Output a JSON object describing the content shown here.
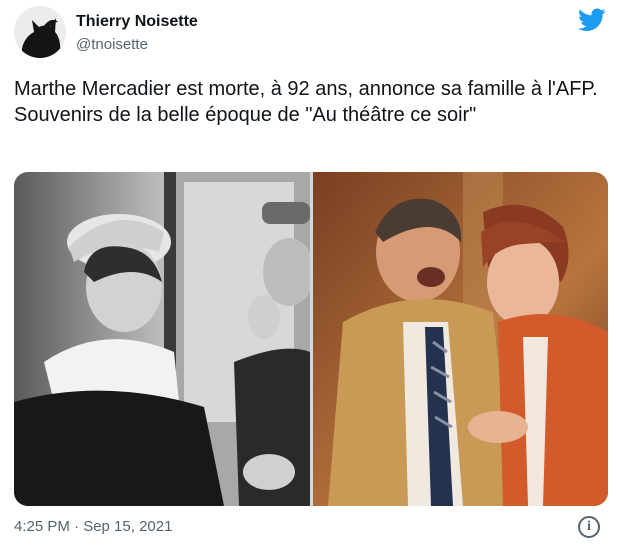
{
  "author": {
    "display_name": "Thierry Noisette",
    "handle": "@tnoisette",
    "avatar_icon": "cat-silhouette-avatar"
  },
  "brand": {
    "icon": "twitter-bird-icon",
    "color": "#1d9bf0"
  },
  "tweet": {
    "text": "Marthe Mercadier est morte, à 92 ans, annonce sa famille à l'AFP. Souvenirs de la belle époque de \"Au théâtre ce soir\"",
    "media": [
      {
        "kind": "photo",
        "style": "black-and-white"
      },
      {
        "kind": "photo",
        "style": "color"
      }
    ],
    "timestamp": "4:25 PM · Sep 15, 2021"
  },
  "colors": {
    "text_primary": "#0f1419",
    "text_secondary": "#536471"
  },
  "footer": {
    "info_icon": "info-icon",
    "info_glyph": "i"
  }
}
